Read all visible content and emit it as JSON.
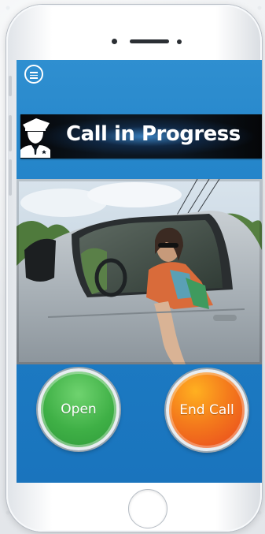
{
  "screen": {
    "title": "Call in Progress",
    "menu_icon": "hamburger-menu-icon",
    "banner_icon": "security-guard-icon",
    "video": "live-intercom-video-feed",
    "colors": {
      "screen_blue": "#1d7ec6",
      "banner_black": "#0c1620",
      "open_green": "#3fb046",
      "end_call_orange": "#f47a1c"
    }
  },
  "actions": {
    "open_label": "Open",
    "end_call_label": "End Call"
  },
  "device": {
    "home_button_icon": "home-button-icon"
  }
}
